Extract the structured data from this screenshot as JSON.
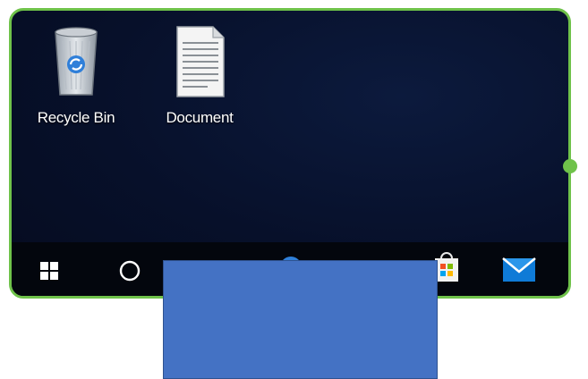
{
  "desktop": {
    "icons": [
      {
        "label": "Recycle Bin",
        "icon": "recycle-bin-icon"
      },
      {
        "label": "Document",
        "icon": "document-icon"
      }
    ]
  },
  "taskbar": {
    "items": [
      {
        "icon": "windows-start-icon"
      },
      {
        "icon": "cortana-search-icon"
      },
      {
        "icon": "edge-browser-icon"
      },
      {
        "icon": "store-bag-icon"
      },
      {
        "icon": "mail-icon"
      }
    ]
  },
  "colors": {
    "selection_outline": "#6fc24a",
    "desktop_background": "#07102a",
    "taskbar_background": "#03060d",
    "overlay_rectangle": "#4472c4"
  }
}
